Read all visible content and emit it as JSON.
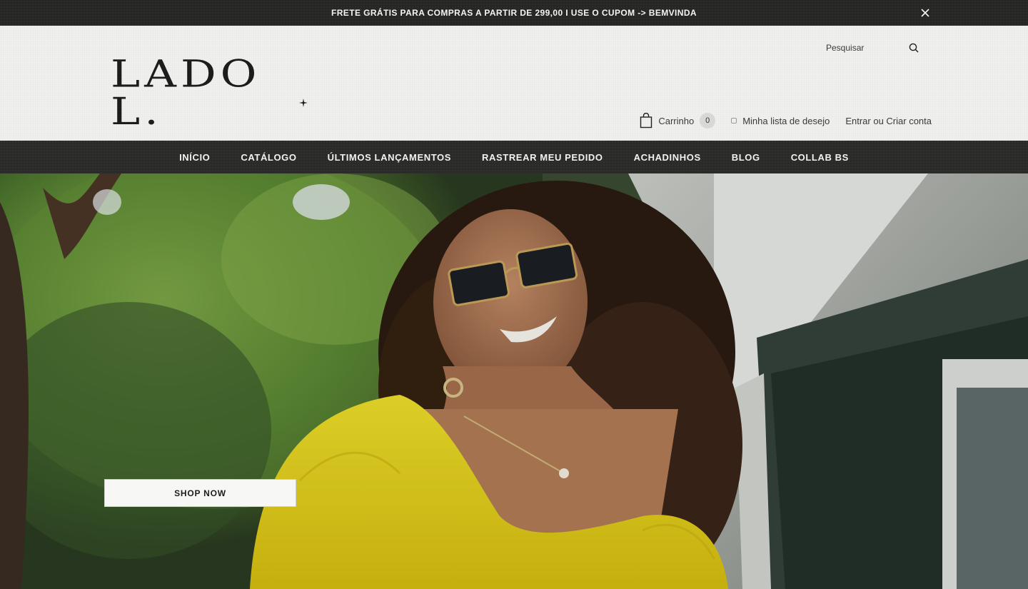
{
  "announcement": {
    "text": "FRETE GRÁTIS PARA COMPRAS A PARTIR DE 299,00 I USE O CUPOM -> BEMVINDA",
    "close_icon": "close-icon"
  },
  "header": {
    "logo_text": "LADO L.",
    "search": {
      "placeholder": "Pesquisar",
      "icon": "search-icon"
    },
    "cart": {
      "label": "Carrinho",
      "count": "0",
      "icon": "shopping-bag-icon"
    },
    "wishlist": {
      "label": "Minha lista de desejo",
      "icon": "heart-icon"
    },
    "account": {
      "label": "Entrar ou Criar conta"
    }
  },
  "nav": {
    "items": [
      {
        "label": "INÍCIO"
      },
      {
        "label": "CATÁLOGO"
      },
      {
        "label": "ÚLTIMOS LANÇAMENTOS"
      },
      {
        "label": "RASTREAR MEU PEDIDO"
      },
      {
        "label": "ACHADINHOS"
      },
      {
        "label": "BLOG"
      },
      {
        "label": "COLLAB BS"
      }
    ]
  },
  "hero": {
    "button_label": "SHOP NOW"
  },
  "colors": {
    "dark_bar": "#262624",
    "header_bg": "#f0f0ee",
    "text_dark": "#1c1c1c",
    "dress_yellow": "#e6d21a"
  }
}
